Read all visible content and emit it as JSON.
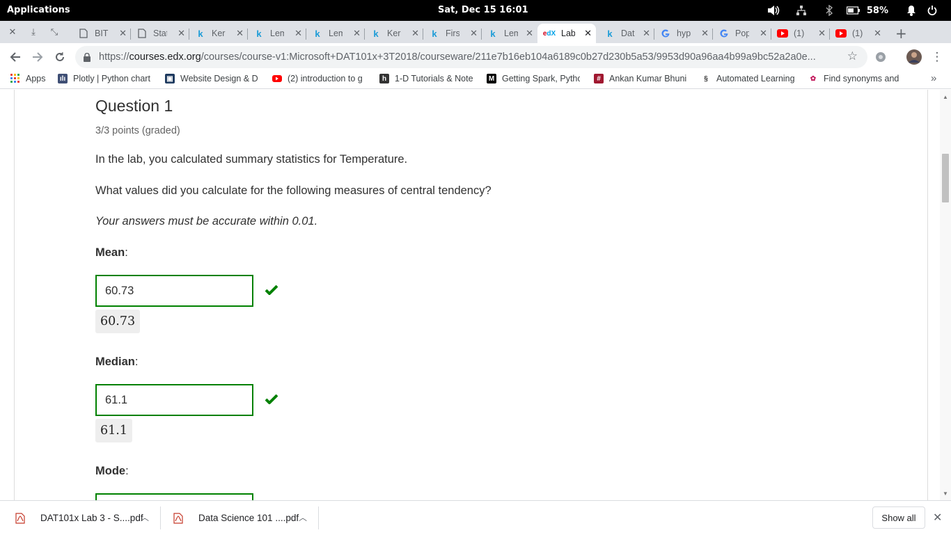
{
  "topbar": {
    "activities": "Applications",
    "clock": "Sat, Dec 15   16:01",
    "battery_pct": "58%"
  },
  "tabs": [
    {
      "title": "BIT",
      "icon": "document-icon"
    },
    {
      "title": "Stat",
      "icon": "document-icon"
    },
    {
      "title": "Ker",
      "icon": "k-icon"
    },
    {
      "title": "Lem",
      "icon": "k-icon"
    },
    {
      "title": "Lem",
      "icon": "k-icon"
    },
    {
      "title": "Ker",
      "icon": "k-icon"
    },
    {
      "title": "Firs",
      "icon": "k-icon"
    },
    {
      "title": "Lem",
      "icon": "k-icon"
    },
    {
      "title": "Lab",
      "icon": "edx-icon"
    },
    {
      "title": "Dat",
      "icon": "k-icon"
    },
    {
      "title": "hyp",
      "icon": "google-icon"
    },
    {
      "title": "Pop",
      "icon": "google-icon"
    },
    {
      "title": "(1) ",
      "icon": "youtube-icon"
    },
    {
      "title": "(1) ",
      "icon": "youtube-icon"
    }
  ],
  "address": {
    "scheme": "https://",
    "host": "courses.edx.org",
    "path": "/courses/course-v1:Microsoft+DAT101x+3T2018/courseware/211e7b16eb104a6189c0b27d230b5a53/9953d90a96aa4b99a9bc52a2a0e..."
  },
  "bookmarks": [
    {
      "label": "Apps",
      "icon": "apps-grid-icon"
    },
    {
      "label": "Plotly | Python chart",
      "icon": "plotly-icon"
    },
    {
      "label": "Website Design & D",
      "icon": "website-icon"
    },
    {
      "label": "(2) introduction to g",
      "icon": "youtube-icon"
    },
    {
      "label": "1-D Tutorials & Note",
      "icon": "h-icon"
    },
    {
      "label": "Getting Spark, Pytho",
      "icon": "medium-icon"
    },
    {
      "label": "Ankan Kumar Bhuni",
      "icon": "hashnode-icon"
    },
    {
      "label": "Automated Learning",
      "icon": "dna-icon"
    },
    {
      "label": "Find synonyms and",
      "icon": "synonym-icon"
    }
  ],
  "question": {
    "title": "Question 1",
    "points": "3/3 points (graded)",
    "prompt1": "In the lab, you calculated summary statistics for Temperature.",
    "prompt2": "What values did you calculate for the following measures of central tendency?",
    "note": "Your answers must be accurate within 0.01.",
    "mean_label": "Mean",
    "mean_value": "60.73",
    "mean_preview": "60.73",
    "median_label": "Median",
    "median_value": "61.1",
    "median_preview": "61.1",
    "mode_label": "Mode",
    "colon": ":"
  },
  "downloads": [
    {
      "name": "DAT101x Lab 3 - S....pdf"
    },
    {
      "name": "Data Science 101 ....pdf"
    }
  ],
  "show_all": "Show all",
  "colors": {
    "correct": "#008100",
    "text": "#313131"
  }
}
